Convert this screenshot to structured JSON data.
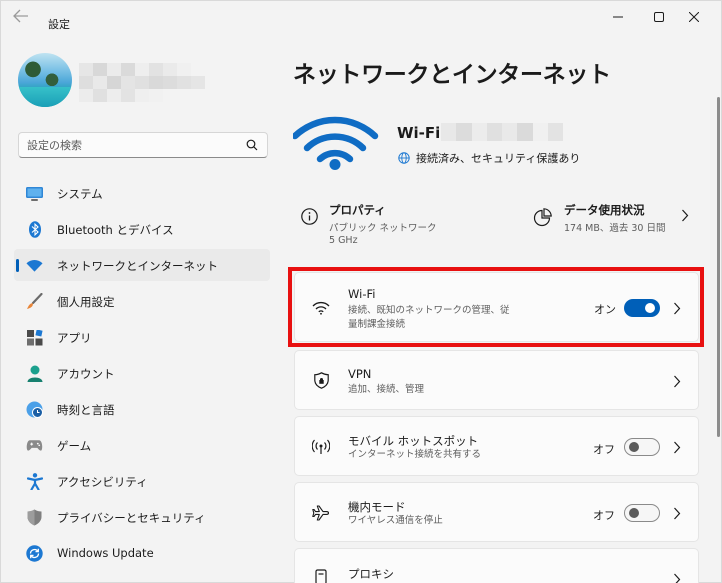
{
  "window": {
    "title": "設定"
  },
  "sidebar": {
    "search_placeholder": "設定の検索",
    "items": [
      {
        "label": "システム",
        "icon": "system-monitor-icon",
        "active": false
      },
      {
        "label": "Bluetooth とデバイス",
        "icon": "bluetooth-icon",
        "active": false
      },
      {
        "label": "ネットワークとインターネット",
        "icon": "wifi-icon",
        "active": true
      },
      {
        "label": "個人用設定",
        "icon": "paintbrush-icon",
        "active": false
      },
      {
        "label": "アプリ",
        "icon": "apps-icon",
        "active": false
      },
      {
        "label": "アカウント",
        "icon": "person-icon",
        "active": false
      },
      {
        "label": "時刻と言語",
        "icon": "clock-globe-icon",
        "active": false
      },
      {
        "label": "ゲーム",
        "icon": "gamepad-icon",
        "active": false
      },
      {
        "label": "アクセシビリティ",
        "icon": "accessibility-icon",
        "active": false
      },
      {
        "label": "プライバシーとセキュリティ",
        "icon": "shield-icon",
        "active": false
      },
      {
        "label": "Windows Update",
        "icon": "update-icon",
        "active": false
      }
    ]
  },
  "main": {
    "title": "ネットワークとインターネット",
    "connection": {
      "name": "Wi-Fi",
      "status": "接続済み、セキュリティ保護あり"
    },
    "properties": {
      "title": "プロパティ",
      "line1": "パブリック ネットワーク",
      "line2": "5 GHz"
    },
    "data_usage": {
      "title": "データ使用状況",
      "detail": "174 MB、過去 30 日間"
    },
    "cards": {
      "wifi": {
        "title": "Wi-Fi",
        "subtitle": "接続、既知のネットワークの管理、従量制課金接続",
        "toggle_label": "オン",
        "toggle_on": true
      },
      "vpn": {
        "title": "VPN",
        "subtitle": "追加、接続、管理"
      },
      "hotspot": {
        "title": "モバイル ホットスポット",
        "subtitle": "インターネット接続を共有する",
        "toggle_label": "オフ",
        "toggle_on": false
      },
      "airplane": {
        "title": "機内モード",
        "subtitle": "ワイヤレス通信を停止",
        "toggle_label": "オフ",
        "toggle_on": false
      },
      "proxy": {
        "title": "プロキシ"
      }
    }
  },
  "colors": {
    "accent": "#005fb8",
    "highlight": "#e81010",
    "background": "#f3f3f3"
  }
}
